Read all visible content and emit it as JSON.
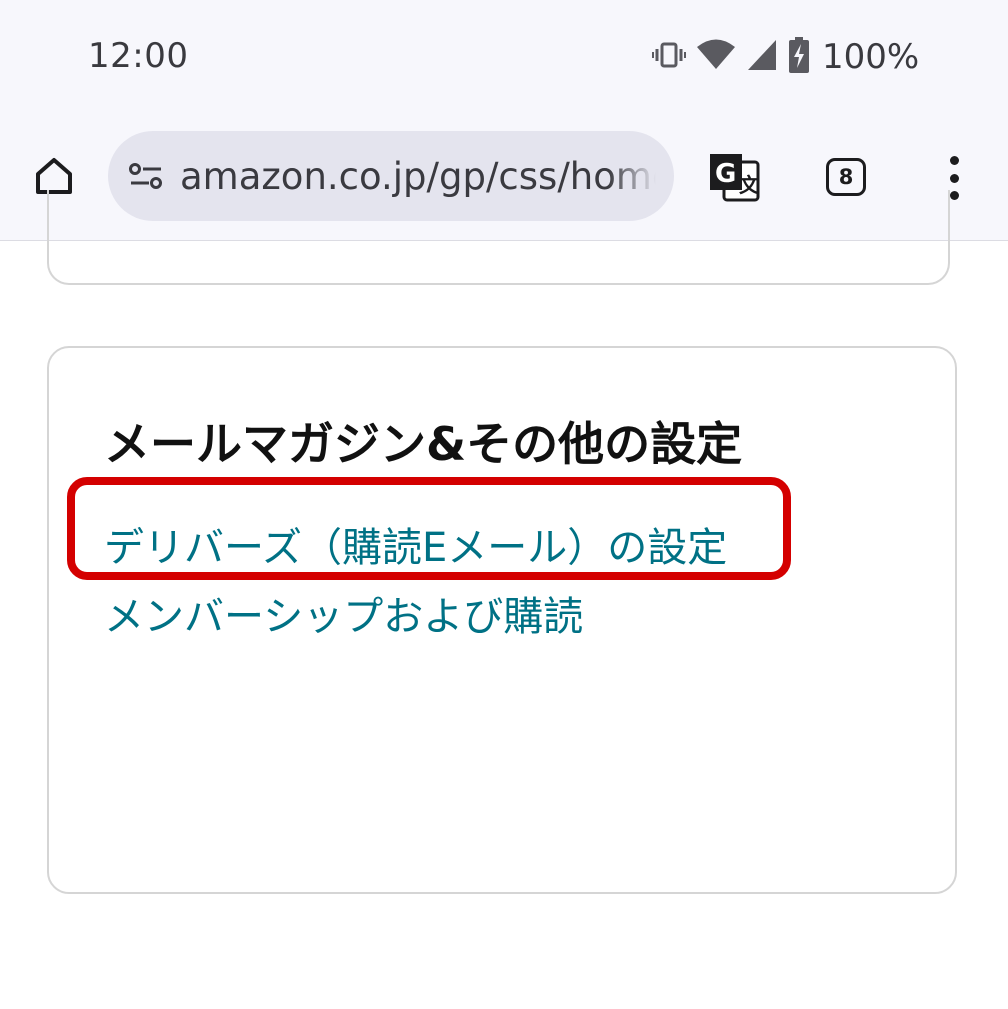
{
  "status_bar": {
    "time": "12:00",
    "battery_percent": "100%",
    "icons": [
      "vibrate-icon",
      "wifi-icon",
      "signal-icon",
      "battery-charging-icon"
    ]
  },
  "browser": {
    "url": "amazon.co.jp/gp/css/home",
    "tab_count": "8",
    "icons": [
      "home-icon",
      "site-settings-icon",
      "translate-icon",
      "tabs-icon",
      "more-menu-icon"
    ]
  },
  "card": {
    "title": "メールマガジン&その他の設定",
    "links": [
      "デリバーズ（購読Eメール）の設定",
      "メンバーシップおよび購読"
    ]
  },
  "annotation": {
    "highlight_color": "#d40000"
  },
  "colors": {
    "link": "#007185",
    "chrome_bg": "#f7f7fc",
    "urlbar_bg": "#e4e4ee"
  }
}
